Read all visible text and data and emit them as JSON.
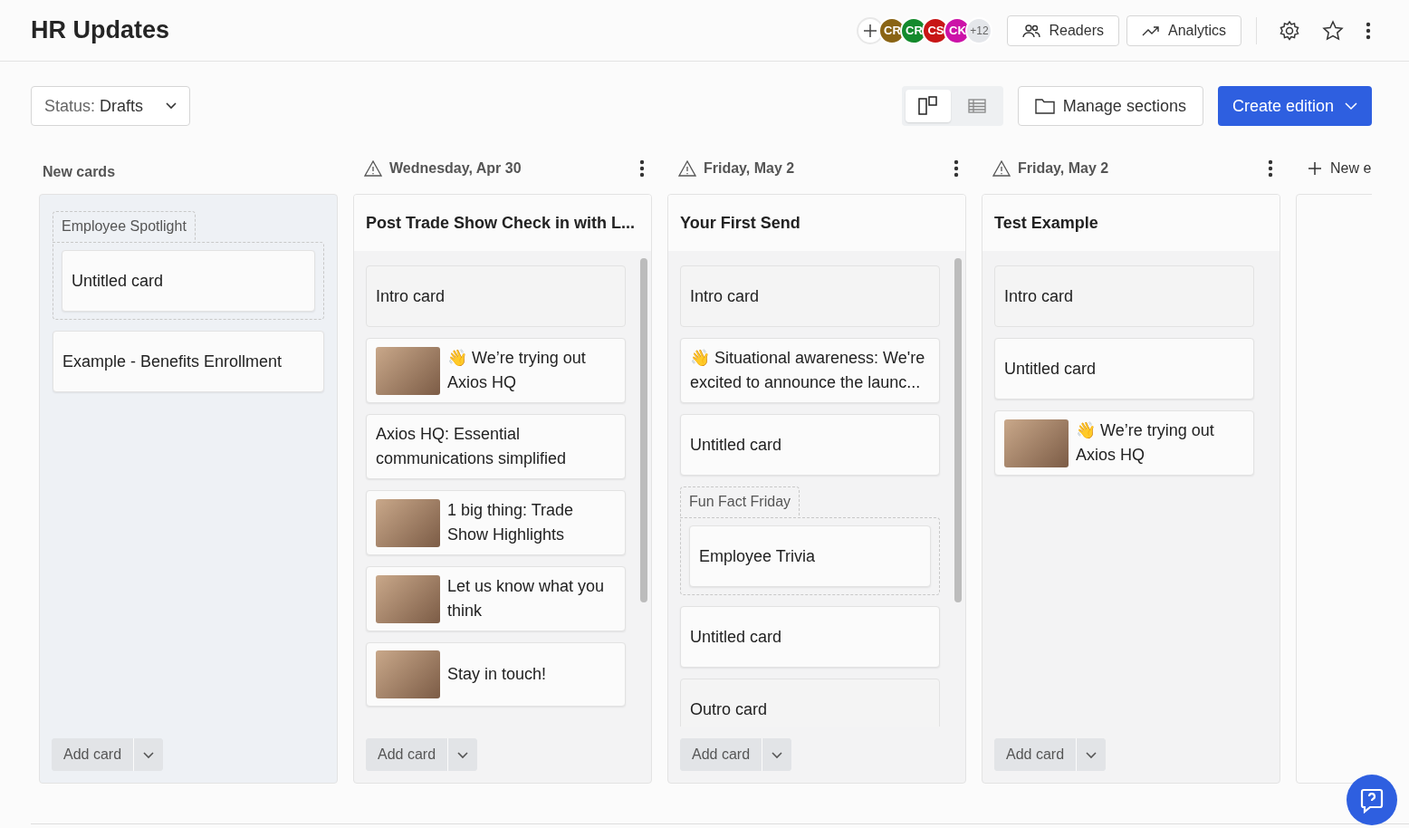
{
  "header": {
    "title": "HR Updates",
    "avatars": [
      {
        "initials": "CR",
        "color": "#8a6414"
      },
      {
        "initials": "CR",
        "color": "#148a2c"
      },
      {
        "initials": "CS",
        "color": "#c81616"
      },
      {
        "initials": "CK",
        "color": "#cc12a8"
      }
    ],
    "more_count": "+12",
    "buttons": [
      {
        "label": "Readers"
      },
      {
        "label": "Analytics"
      }
    ]
  },
  "toolbar": {
    "status": {
      "label": "Status:",
      "value": "Drafts"
    },
    "views": [
      {
        "kind": "board",
        "selected": true
      },
      {
        "kind": "table",
        "selected": false
      }
    ],
    "manage_sections": "Manage sections",
    "create_edition": "Create edition"
  },
  "columns": [
    {
      "kind": "inbox",
      "label": "New cards",
      "add_card": "Add card",
      "items": [
        {
          "kind": "group",
          "label": "Employee Spotlight",
          "cards": [
            {
              "kind": "card",
              "text": "Untitled card"
            }
          ]
        },
        {
          "kind": "card",
          "text": "Example - Benefits Enrollment"
        }
      ]
    },
    {
      "kind": "edition",
      "date": "Wednesday, Apr 30",
      "warning": true,
      "title": "Post Trade Show Check in with L...",
      "add_card": "Add card",
      "items": [
        {
          "kind": "placeholder",
          "text": "Intro card"
        },
        {
          "kind": "card",
          "text": "👋 We’re trying out Axios HQ",
          "thumbnail": true
        },
        {
          "kind": "card",
          "text": "Axios HQ: Essential communications simplified"
        },
        {
          "kind": "card",
          "text": "1 big thing: Trade Show Highlights",
          "thumbnail": true
        },
        {
          "kind": "card",
          "text": "Let us know what you think",
          "thumbnail": true
        },
        {
          "kind": "card",
          "text": "Stay in touch!",
          "thumbnail": true
        }
      ]
    },
    {
      "kind": "edition",
      "date": "Friday, May 2",
      "warning": true,
      "title": "Your First Send",
      "add_card": "Add card",
      "items": [
        {
          "kind": "placeholder",
          "text": "Intro card"
        },
        {
          "kind": "card",
          "text": "👋 Situational awareness: We're excited to announce the launc..."
        },
        {
          "kind": "card",
          "text": "Untitled card"
        },
        {
          "kind": "group",
          "label": "Fun Fact Friday",
          "cards": [
            {
              "kind": "card",
              "text": "Employee Trivia"
            }
          ]
        },
        {
          "kind": "card",
          "text": "Untitled card"
        },
        {
          "kind": "placeholder",
          "text": "Outro card"
        }
      ]
    },
    {
      "kind": "edition",
      "date": "Friday, May 2",
      "warning": true,
      "title": "Test Example",
      "add_card": "Add card",
      "items": [
        {
          "kind": "placeholder",
          "text": "Intro card"
        },
        {
          "kind": "card",
          "text": "Untitled card"
        },
        {
          "kind": "card",
          "text": "👋 We’re trying out Axios HQ",
          "thumbnail": true
        }
      ]
    },
    {
      "kind": "new",
      "label": "New e"
    }
  ]
}
